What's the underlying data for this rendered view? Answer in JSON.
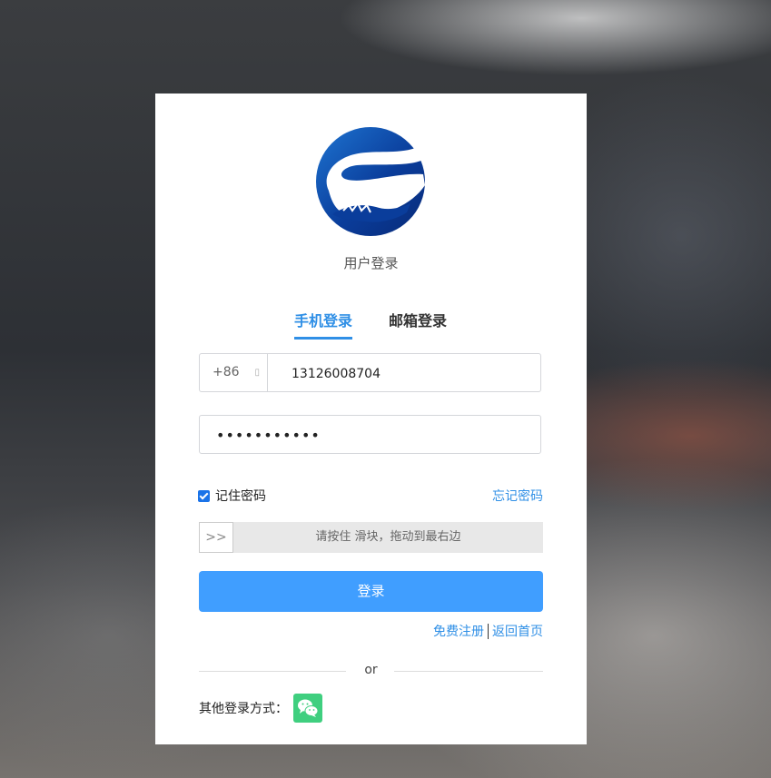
{
  "header": {
    "subtitle": "用户登录"
  },
  "tabs": [
    {
      "label": "手机登录",
      "active": true
    },
    {
      "label": "邮箱登录",
      "active": false
    }
  ],
  "phone": {
    "prefix": "+86",
    "value": "13126008704"
  },
  "password": {
    "value": "•••••••••••"
  },
  "remember": {
    "label": "记住密码",
    "checked": true
  },
  "forgot_label": "忘记密码",
  "slider": {
    "handle": ">>",
    "text": "请按住 滑块，拖动到最右边"
  },
  "login_button": "登录",
  "links": {
    "register": "免费注册",
    "home": "返回首页"
  },
  "divider": "or",
  "other_login": {
    "label": "其他登录方式：",
    "icon": "wechat-icon"
  },
  "colors": {
    "accent": "#2f8fe6",
    "button": "#409eff",
    "wechat": "#3fcf7f"
  }
}
